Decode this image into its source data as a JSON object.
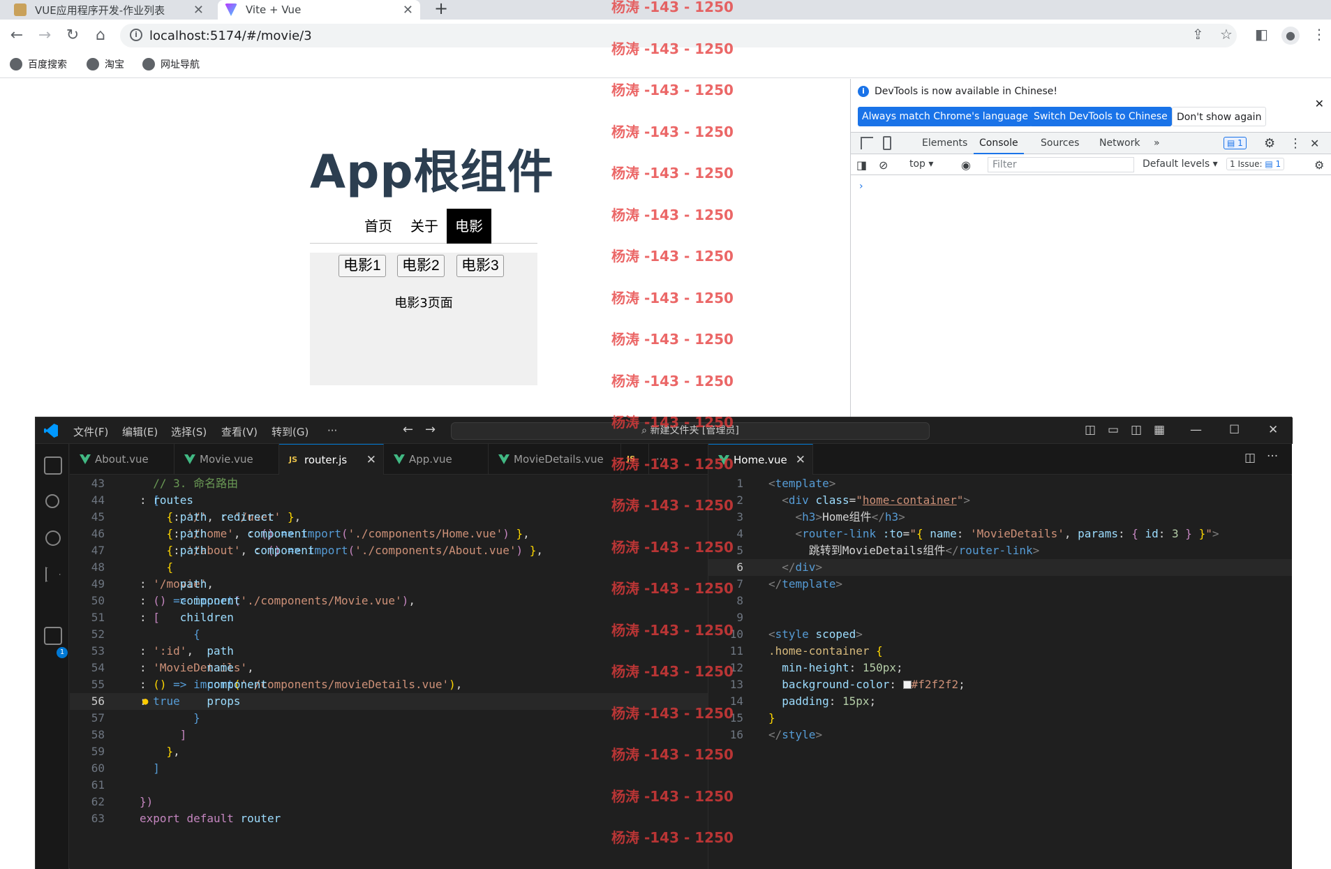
{
  "browser": {
    "tabs": [
      {
        "title": "VUE应用程序开发-作业列表"
      },
      {
        "title": "Vite + Vue"
      }
    ],
    "url": "localhost:5174/#/movie/3",
    "bookmarks": [
      "百度搜索",
      "淘宝",
      "网址导航"
    ]
  },
  "page": {
    "title": "App根组件",
    "nav": [
      "首页",
      "关于",
      "电影"
    ],
    "movie_buttons": [
      "电影1",
      "电影2",
      "电影3"
    ],
    "movie_page_text": "电影3页面"
  },
  "devtools": {
    "info_text": "DevTools is now available in Chinese!",
    "buttons": [
      "Always match Chrome's language",
      "Switch DevTools to Chinese",
      "Don't show again"
    ],
    "tabs": [
      "Elements",
      "Console",
      "Sources",
      "Network"
    ],
    "message_count": "1",
    "context": "top",
    "filter_placeholder": "Filter",
    "levels": "Default levels",
    "issues": "1 Issue:",
    "issue_count": "1",
    "prompt": "›"
  },
  "vscode": {
    "menu": [
      "文件(F)",
      "编辑(E)",
      "选择(S)",
      "查看(V)",
      "转到(G)",
      "···"
    ],
    "command_center": "新建文件夹 [管理员]",
    "left_tabs": [
      "About.vue",
      "Movie.vue",
      "router.js",
      "App.vue",
      "MovieDetails.vue",
      "JS"
    ],
    "right_tabs": [
      "Home.vue"
    ],
    "extensions_badge": "1",
    "left_line_numbers": [
      "43",
      "44",
      "45",
      "46",
      "47",
      "48",
      "49",
      "50",
      "51",
      "52",
      "53",
      "54",
      "55",
      "56",
      "57",
      "58",
      "59",
      "60",
      "61",
      "62",
      "63"
    ],
    "right_line_numbers": [
      "1",
      "2",
      "3",
      "4",
      "5",
      "6",
      "7",
      "8",
      "9",
      "10",
      "11",
      "12",
      "13",
      "14",
      "15",
      "16"
    ]
  },
  "watermark": "杨涛 -143 - 1250"
}
